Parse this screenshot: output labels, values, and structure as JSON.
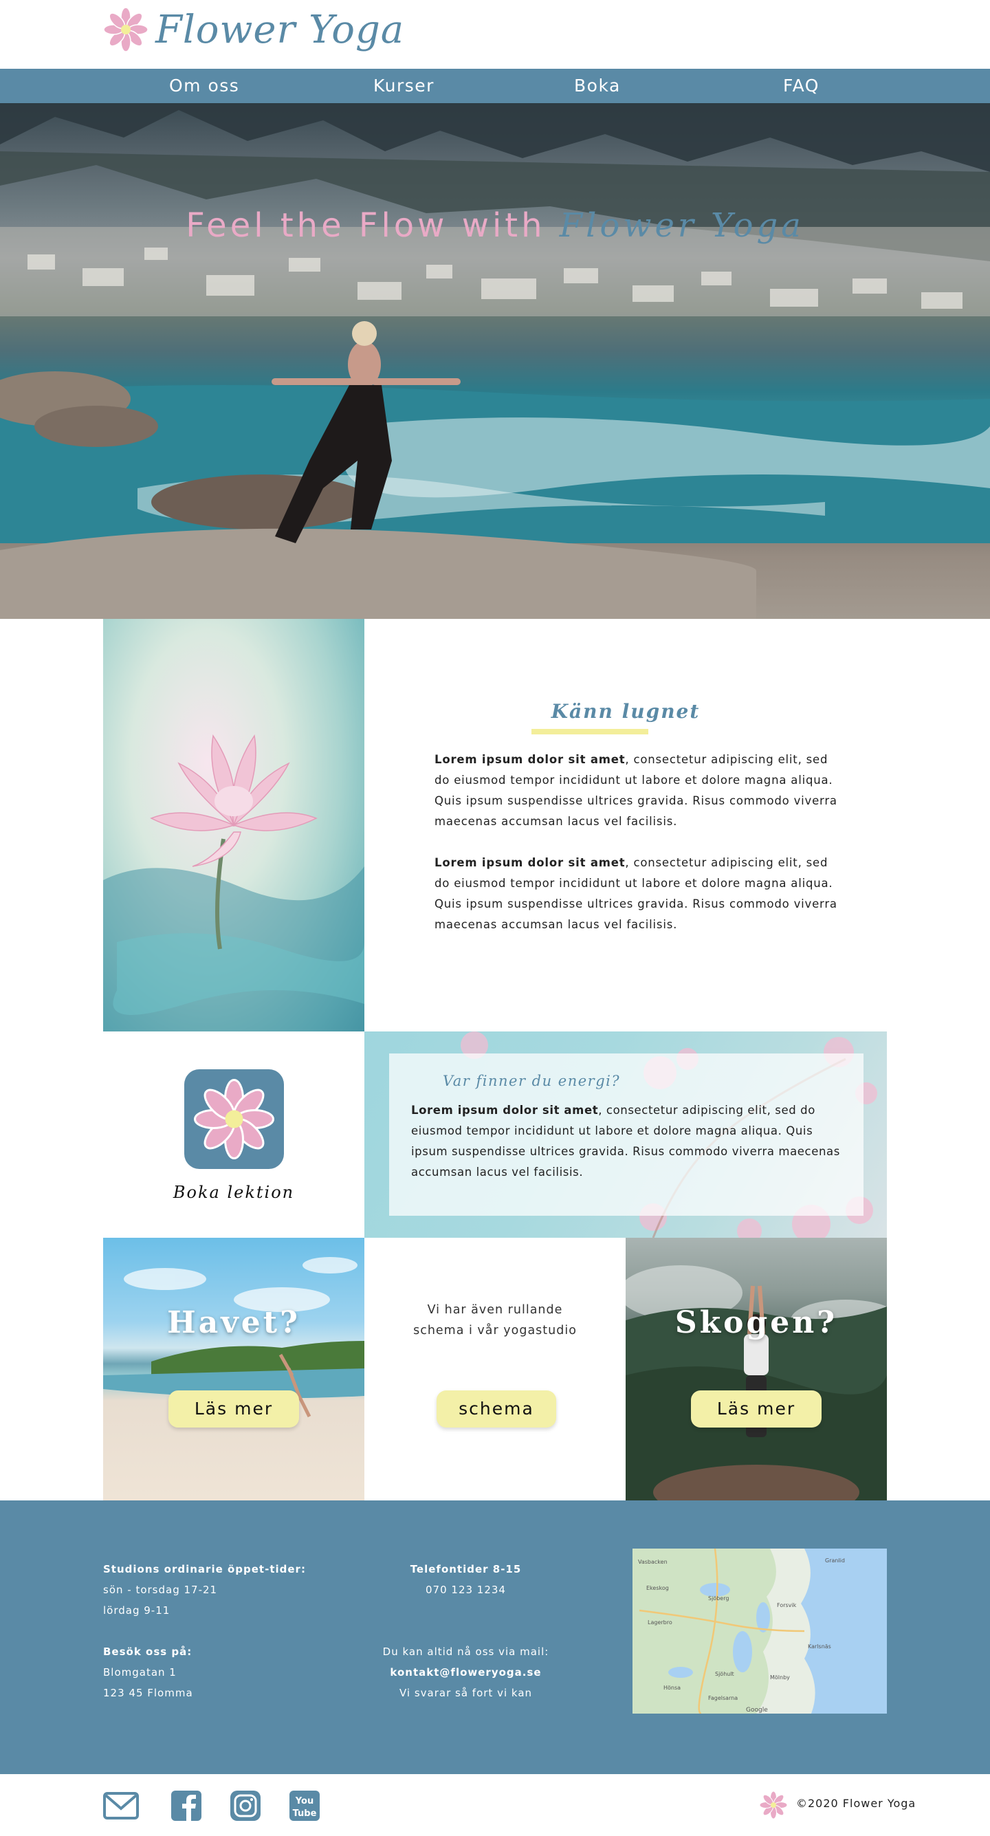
{
  "brand": {
    "name": "Flower Yoga",
    "primary_color": "#5a8aa6",
    "accent_pink": "#e9aac6",
    "accent_yellow": "#f3ee9a",
    "logo_icon": "lotus-flower-icon"
  },
  "nav": {
    "items": [
      {
        "label": "Om oss"
      },
      {
        "label": "Kurser"
      },
      {
        "label": "Boka"
      },
      {
        "label": "FAQ"
      }
    ]
  },
  "hero": {
    "title_part1": "Feel the Flow with",
    "title_part2": "Flower Yoga"
  },
  "intro": {
    "heading": "Känn lugnet",
    "p1_bold": "Lorem ipsum dolor sit amet",
    "p1_rest": ", consectetur adipiscing elit, sed do eiusmod tempor incididunt ut labore et dolore magna aliqua. Quis ipsum suspendisse ultrices gravida. Risus commodo viverra maecenas accumsan lacus vel facilisis.",
    "p2_bold": "Lorem ipsum dolor sit amet",
    "p2_rest": ", consectetur adipiscing elit, sed do eiusmod tempor incididunt ut labore et dolore magna aliqua. Quis ipsum suspendisse ultrices gravida. Risus commodo viverra maecenas accumsan lacus vel facilisis."
  },
  "booking": {
    "label": "Boka lektion",
    "icon": "lotus-app-icon"
  },
  "energy": {
    "title": "Var finner du energi?",
    "text_bold": "Lorem ipsum dolor sit amet",
    "text_rest": ", consectetur adipiscing elit, sed do eiusmod tempor incididunt ut labore et dolore magna aliqua. Quis ipsum suspendisse ultrices gravida. Risus commodo viverra maecenas accumsan lacus vel facilisis."
  },
  "tiles": {
    "beach": {
      "title": "Havet?",
      "button": "Läs mer"
    },
    "middle": {
      "text_line1": "Vi har även rullande",
      "text_line2": "schema i vår yogastudio",
      "button": "schema"
    },
    "forest": {
      "title": "Skogen?",
      "button": "Läs mer"
    }
  },
  "footer": {
    "hours_title": "Studions ordinarie öppet-tider:",
    "hours_line1": "sön - torsdag 17-21",
    "hours_line2": "lördag 9-11",
    "visit_title": "Besök oss på:",
    "visit_line1": "Blomgatan 1",
    "visit_line2": "123 45 Flomma",
    "phone_title": "Telefontider 8-15",
    "phone_number": "070 123 1234",
    "mail_intro": "Du kan altid nå oss via mail:",
    "mail_address": "kontakt@floweryoga.se",
    "mail_note": "Vi svarar så fort vi kan",
    "map_labels": [
      "Vasbacken",
      "Granlid",
      "Ekeskog",
      "Sjöberg",
      "Forsvik",
      "Lagerbro",
      "Karlsnäs",
      "Sjöhult",
      "Mölnby",
      "Hönsa",
      "Fagelsarna",
      "Google"
    ]
  },
  "bottom": {
    "social": [
      "mail-icon",
      "facebook-icon",
      "instagram-icon",
      "youtube-icon"
    ],
    "youtube_top": "You",
    "youtube_bottom": "Tube",
    "copyright": "©2020 Flower Yoga"
  }
}
